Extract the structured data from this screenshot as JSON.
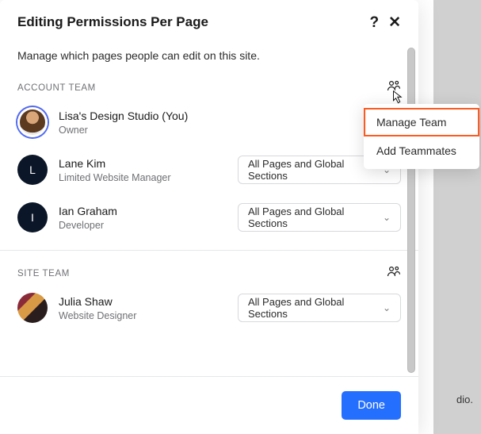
{
  "backdrop_tail": "dio.",
  "header": {
    "title": "Editing Permissions Per Page",
    "subtitle": "Manage which pages people can edit on this site."
  },
  "sections": {
    "account": {
      "label": "ACCOUNT TEAM",
      "members": [
        {
          "name": "Lisa's Design Studio (You)",
          "role": "Owner",
          "avatar": "photo1",
          "perm": null
        },
        {
          "name": "Lane Kim",
          "role": "Limited Website Manager",
          "avatar": "dark",
          "initial": "L",
          "perm": "All Pages and Global Sections"
        },
        {
          "name": "Ian Graham",
          "role": "Developer",
          "avatar": "dark",
          "initial": "I",
          "perm": "All Pages and Global Sections"
        }
      ]
    },
    "site": {
      "label": "SITE TEAM",
      "members": [
        {
          "name": "Julia Shaw",
          "role": "Website Designer",
          "avatar": "photo2",
          "perm": "All Pages and Global Sections"
        }
      ]
    }
  },
  "popover": {
    "item1": "Manage Team",
    "item2": "Add Teammates"
  },
  "footer": {
    "done": "Done"
  }
}
